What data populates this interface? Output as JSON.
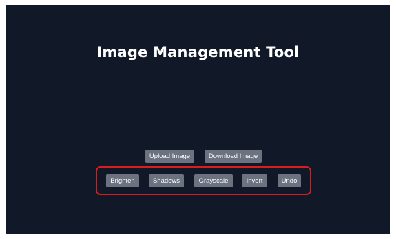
{
  "app": {
    "title": "Image Management Tool"
  },
  "file_actions": {
    "upload_label": "Upload Image",
    "download_label": "Download Image"
  },
  "edit_actions": {
    "brighten_label": "Brighten",
    "shadows_label": "Shadows",
    "grayscale_label": "Grayscale",
    "invert_label": "Invert",
    "undo_label": "Undo"
  },
  "colors": {
    "background": "#111827",
    "button": "#6b7280",
    "highlight": "#d91c1c"
  }
}
